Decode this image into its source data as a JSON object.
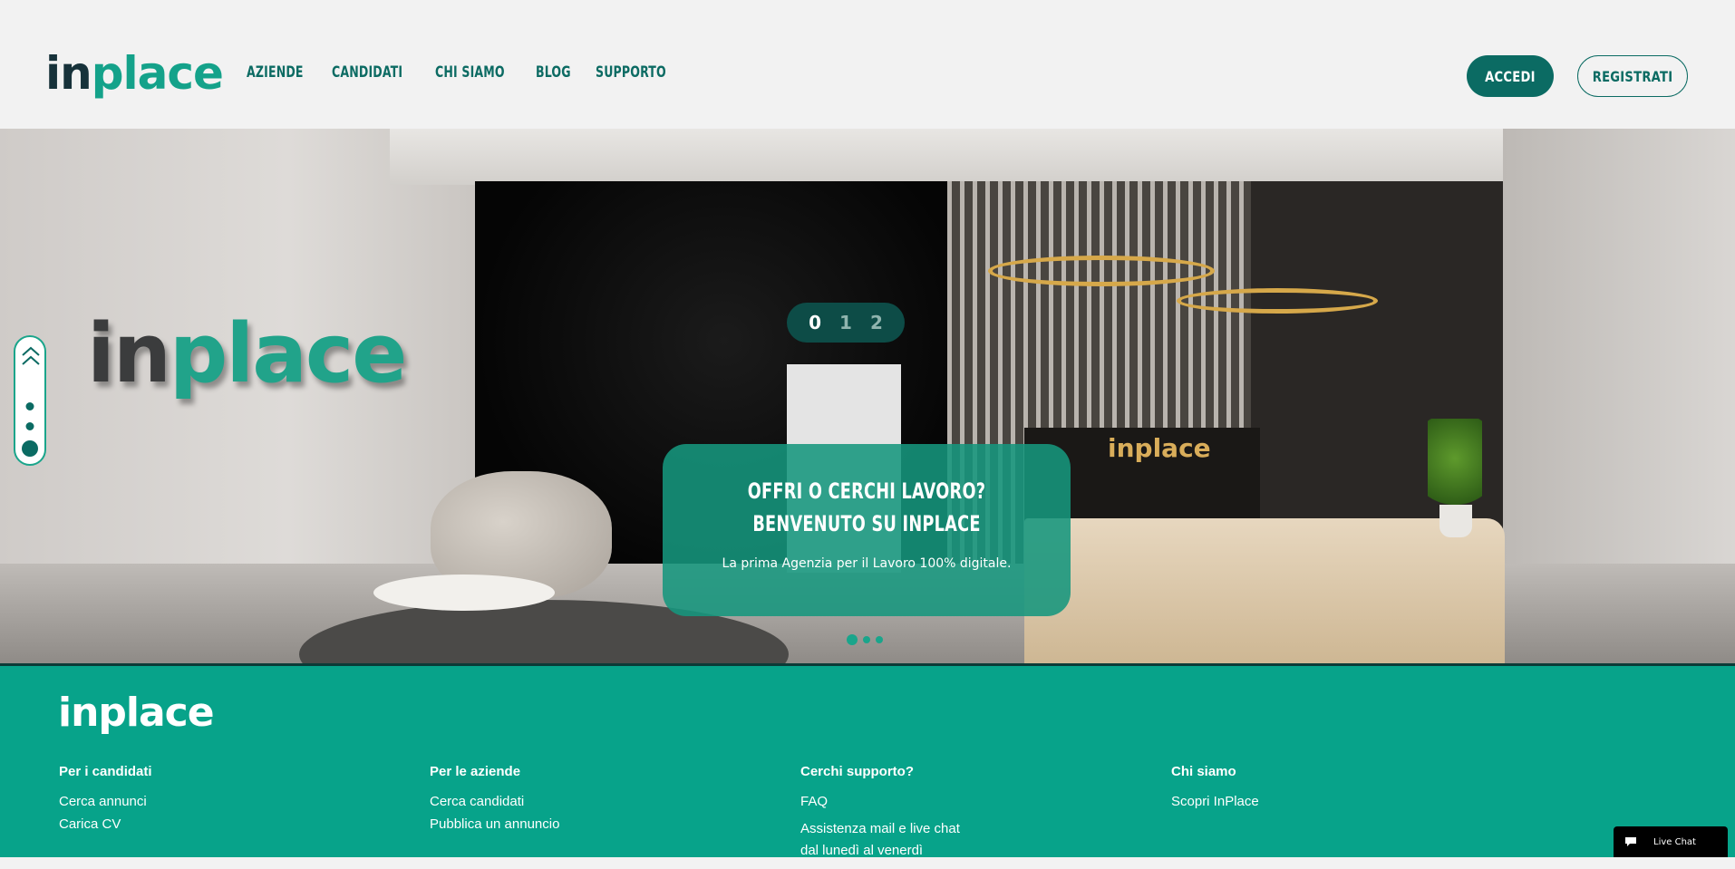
{
  "header": {
    "logo": {
      "part1": "in",
      "part2": "place"
    },
    "nav": [
      "AZIENDE",
      "CANDIDATI",
      "CHI SIAMO",
      "BLOG",
      "SUPPORTO"
    ],
    "login_label": "ACCEDI",
    "register_label": "REGISTRATI"
  },
  "hero": {
    "counter": [
      "0",
      "1",
      "2"
    ],
    "counter_active_index": 0,
    "card": {
      "line1": "OFFRI O CERCHI LAVORO?",
      "line2": "BENVENUTO SU INPLACE",
      "subtitle": "La prima Agenzia per il Lavoro 100% digitale."
    },
    "wall_sign": {
      "part1": "in",
      "part2": "place"
    },
    "desk_sign": "inplace",
    "carousel_active_index": 0,
    "carousel_count": 3,
    "side_pager": {
      "active_index": 2,
      "count": 3
    }
  },
  "footer": {
    "logo": "inplace",
    "columns": [
      {
        "heading": "Per i candidati",
        "links": [
          "Cerca annunci",
          "Carica CV"
        ]
      },
      {
        "heading": "Per le aziende",
        "links": [
          "Cerca candidati",
          "Pubblica un annuncio"
        ]
      },
      {
        "heading": "Cerchi supporto?",
        "links": [
          "FAQ",
          "Assistenza mail e live chat dal lunedì al venerdì"
        ]
      },
      {
        "heading": "Chi siamo",
        "links": [
          "Scopri InPlace"
        ]
      }
    ]
  },
  "live_chat": {
    "label": "Live Chat",
    "icon": "chat-bubble-icon"
  },
  "colors": {
    "brand": "#07a38a",
    "brand_dark": "#0b6b63",
    "text_dark": "#17323a"
  }
}
